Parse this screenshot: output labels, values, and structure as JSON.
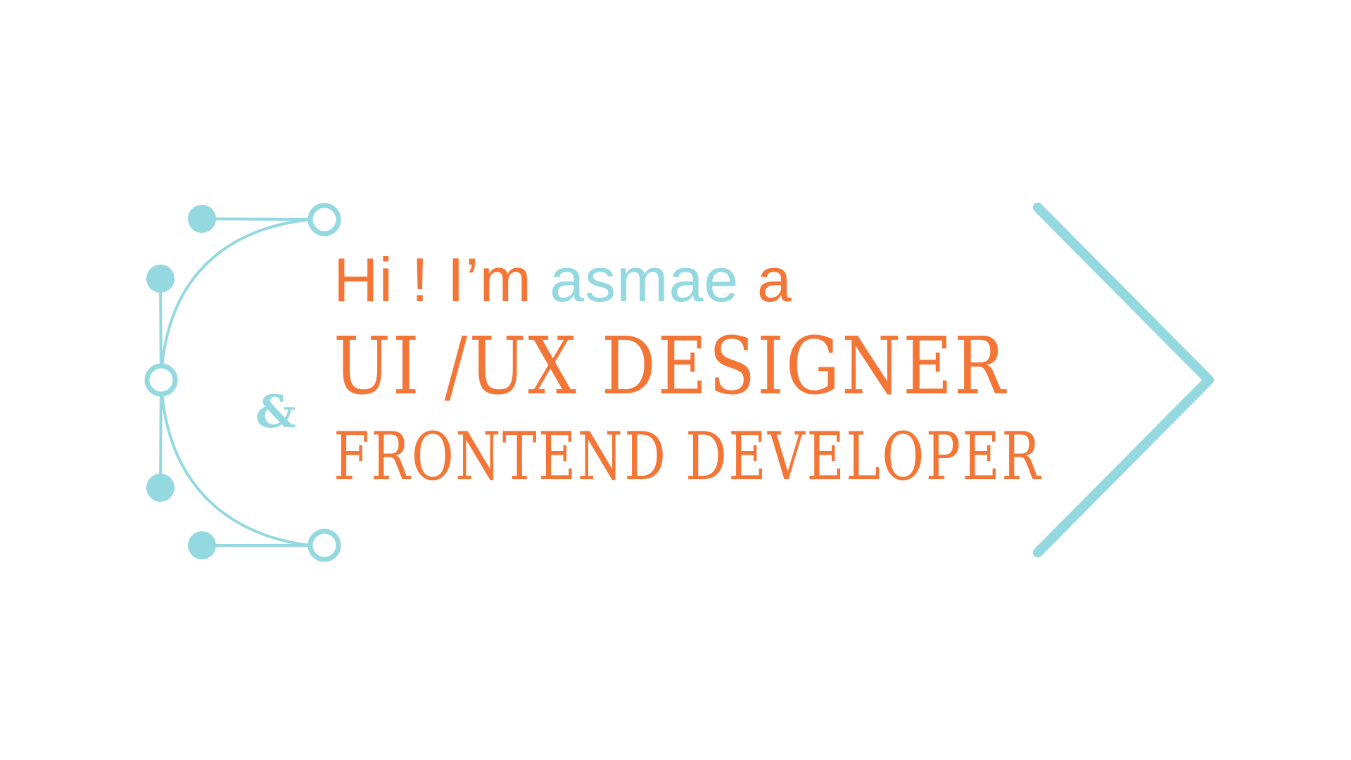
{
  "greeting": {
    "part1": "Hi ! I’m",
    "name": "asmae",
    "part2": "a"
  },
  "role_primary": "UI /UX DESIGNER",
  "ampersand": "&",
  "role_secondary": "FRONTEND DEVELOPER",
  "colors": {
    "orange": "#f47636",
    "teal": "#93d9df",
    "background": "#ffffff"
  },
  "icons": {
    "bezier": "bezier-curve-icon",
    "chevron": "chevron-right-icon"
  }
}
